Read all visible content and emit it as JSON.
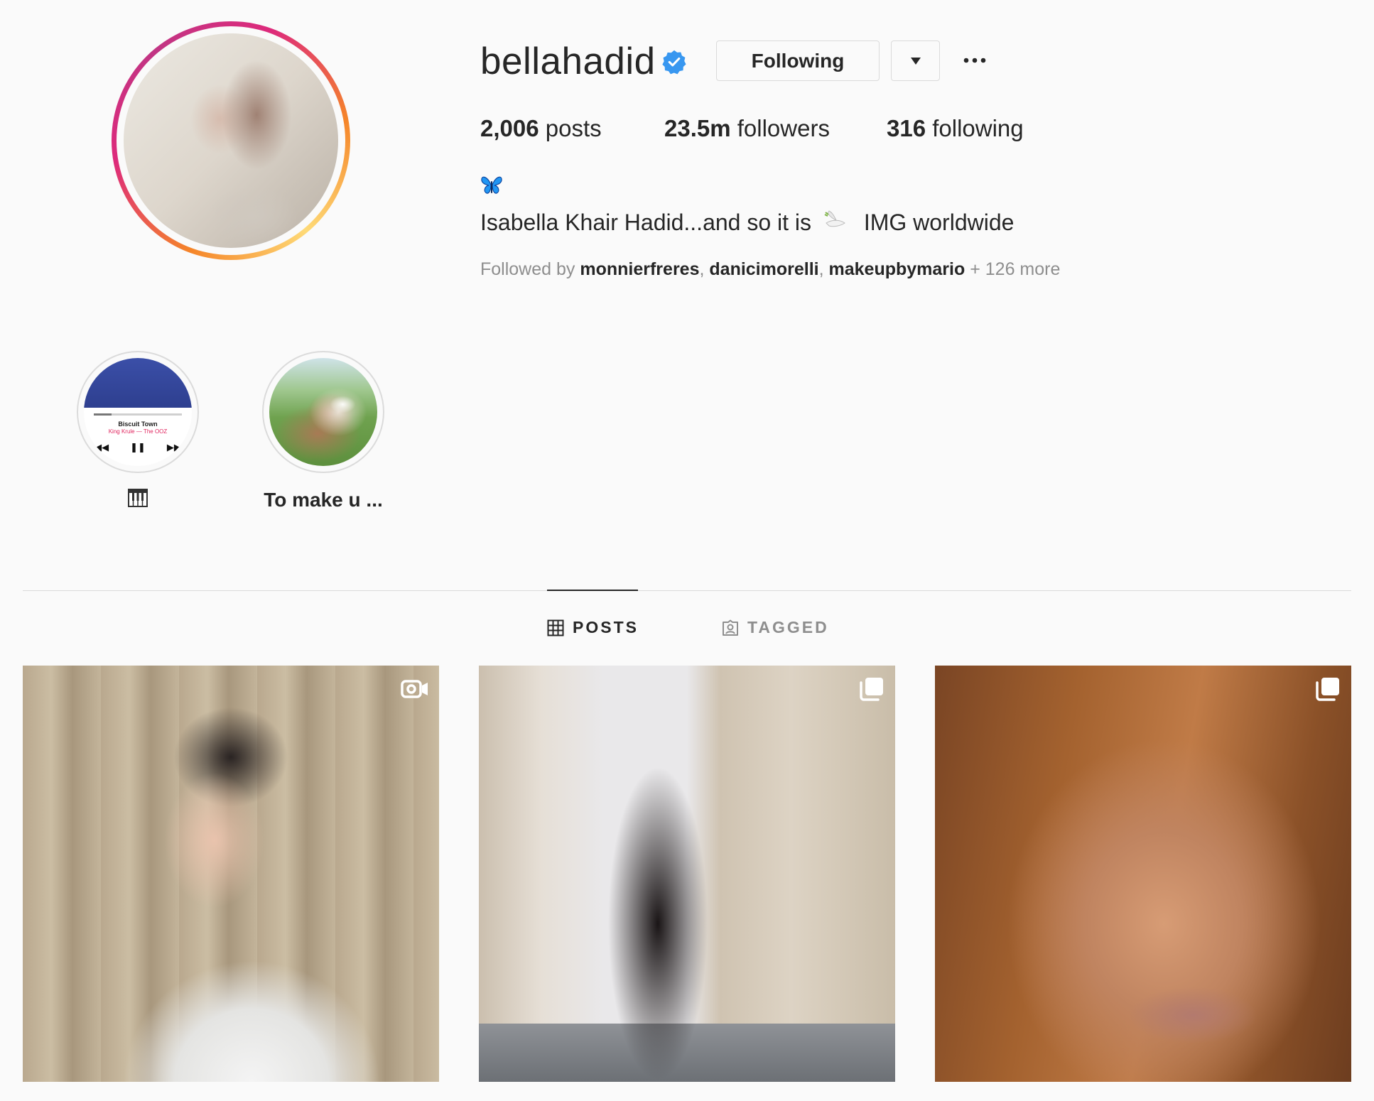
{
  "profile": {
    "username": "bellahadid",
    "following_button": "Following",
    "stats": {
      "posts_count": "2,006",
      "posts_label": " posts",
      "followers_count": "23.5m",
      "followers_label": " followers",
      "following_count": "316",
      "following_label": " following"
    },
    "bio_emoji_icon": "butterfly-emoji",
    "bio_text_1": "Isabella Khair Hadid...and so it is",
    "bio_text_2": "IMG worldwide",
    "followed_by_prefix": "Followed by ",
    "followed_by_users": [
      "monnierfreres",
      "danicimorelli",
      "makeupbymario"
    ],
    "followed_by_suffix": " + 126 more"
  },
  "highlights": [
    {
      "label": "🎹",
      "song_title": "Biscuit Town",
      "song_artist": "King Krule — The OOZ"
    },
    {
      "label": "To make u ..."
    }
  ],
  "tabs": [
    {
      "label": "POSTS",
      "icon": "grid-icon",
      "active": true
    },
    {
      "label": "TAGGED",
      "icon": "tagged-icon",
      "active": false
    }
  ],
  "posts": [
    {
      "type": "video",
      "icon": "igtv-video-icon"
    },
    {
      "type": "carousel",
      "icon": "multiple-posts-icon"
    },
    {
      "type": "carousel",
      "icon": "multiple-posts-icon"
    }
  ],
  "colors": {
    "background": "#fafafa",
    "verified": "#3897f0",
    "text_primary": "#262626",
    "text_secondary": "#8e8e8e",
    "border": "#dbdbdb"
  }
}
